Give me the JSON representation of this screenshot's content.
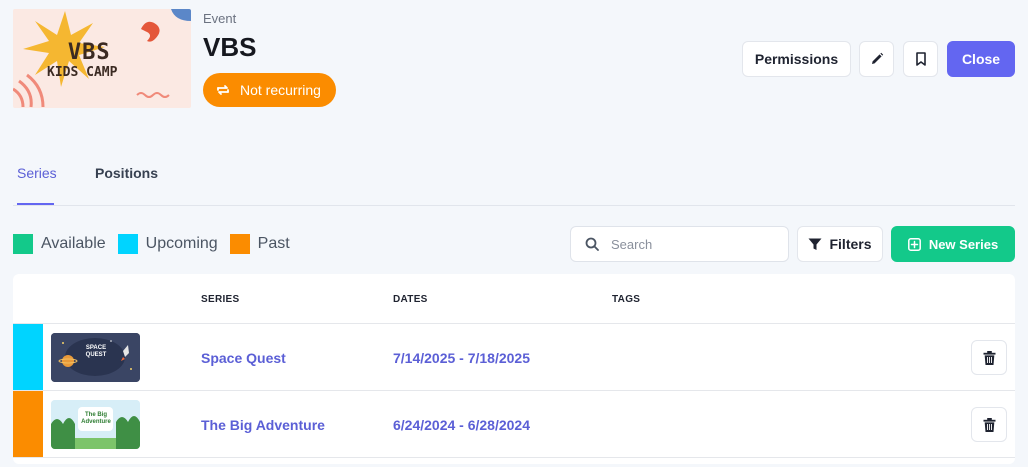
{
  "header": {
    "banner": {
      "title": "VBS",
      "subtitle": "KIDS CAMP",
      "colors": {
        "background": "#fbe9e3",
        "star": "#f5b731",
        "accent": "#e4573a",
        "swirl": "#f08a7a"
      }
    },
    "event_label": "Event",
    "event_title": "VBS",
    "recurring_label": "Not recurring",
    "actions": {
      "permissions_label": "Permissions",
      "edit_icon": "pencil-icon",
      "bookmark_icon": "bookmark-icon",
      "close_label": "Close"
    }
  },
  "tabs": [
    {
      "label": "Series",
      "active": true
    },
    {
      "label": "Positions",
      "active": false
    }
  ],
  "legend": [
    {
      "label": "Available",
      "color": "#13c98a"
    },
    {
      "label": "Upcoming",
      "color": "#00d4ff"
    },
    {
      "label": "Past",
      "color": "#fb8c00"
    }
  ],
  "toolbar": {
    "search_placeholder": "Search",
    "filters_label": "Filters",
    "new_series_label": "New Series"
  },
  "table": {
    "columns": [
      "SERIES",
      "DATES",
      "TAGS"
    ],
    "rows": [
      {
        "status": "Upcoming",
        "status_color": "#00d4ff",
        "thumbnail_text": "SPACE QUEST",
        "series": "Space Quest",
        "dates": "7/14/2025 - 7/18/2025",
        "tags": ""
      },
      {
        "status": "Past",
        "status_color": "#fb8c00",
        "thumbnail_text": "The Big Adventure",
        "series": "The Big Adventure",
        "dates": "6/24/2024 - 6/28/2024",
        "tags": ""
      }
    ]
  },
  "colors": {
    "primary": "#6366f1",
    "success": "#13c98a",
    "warning": "#fb8c00",
    "info": "#00d4ff"
  }
}
